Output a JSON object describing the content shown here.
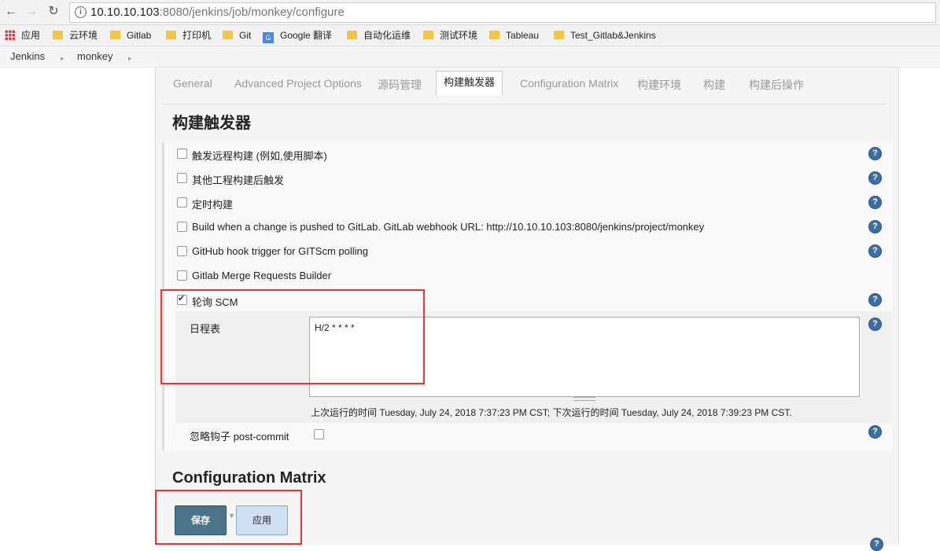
{
  "browser": {
    "url_host": "10.10.10.103",
    "url_path": ":8080/jenkins/job/monkey/configure"
  },
  "bookmarks": [
    "应用",
    "云环境",
    "Gitlab",
    "打印机",
    "Git",
    "Google 翻译",
    "自动化运维",
    "测试环境",
    "Tableau",
    "Test_Gitlab&Jenkins"
  ],
  "breadcrumb": [
    "Jenkins",
    "monkey"
  ],
  "tabs": [
    "General",
    "Advanced Project Options",
    "源码管理",
    "构建触发器",
    "Configuration Matrix",
    "构建环境",
    "构建",
    "构建后操作"
  ],
  "active_tab": "构建触发器",
  "section_title": "构建触发器",
  "triggers": [
    {
      "label": "触发远程构建 (例如,使用脚本)",
      "checked": false
    },
    {
      "label": "其他工程构建后触发",
      "checked": false
    },
    {
      "label": "定时构建",
      "checked": false
    },
    {
      "label": "Build when a change is pushed to GitLab. GitLab webhook URL: http://10.10.10.103:8080/jenkins/project/monkey",
      "checked": false
    },
    {
      "label": "GitHub hook trigger for GITScm polling",
      "checked": false
    },
    {
      "label": "Gitlab Merge Requests Builder",
      "checked": false
    },
    {
      "label": "轮询 SCM",
      "checked": true
    }
  ],
  "schedule": {
    "label": "日程表",
    "value": "H/2 * * * *",
    "run_info": "上次运行的时间 Tuesday, July 24, 2018 7:37:23 PM CST; 下次运行的时间 Tuesday, July 24, 2018 7:39:23 PM CST."
  },
  "ignore_post_commit": {
    "label": "忽略钩子 post-commit",
    "checked": false
  },
  "next_section_title": "Configuration Matrix",
  "buttons": {
    "save": "保存",
    "apply": "应用"
  },
  "colors": {
    "save_bg": "#4b758b",
    "apply_bg": "#cfe0f3",
    "highlight": "#e33333",
    "help": "#3b6ea5"
  }
}
